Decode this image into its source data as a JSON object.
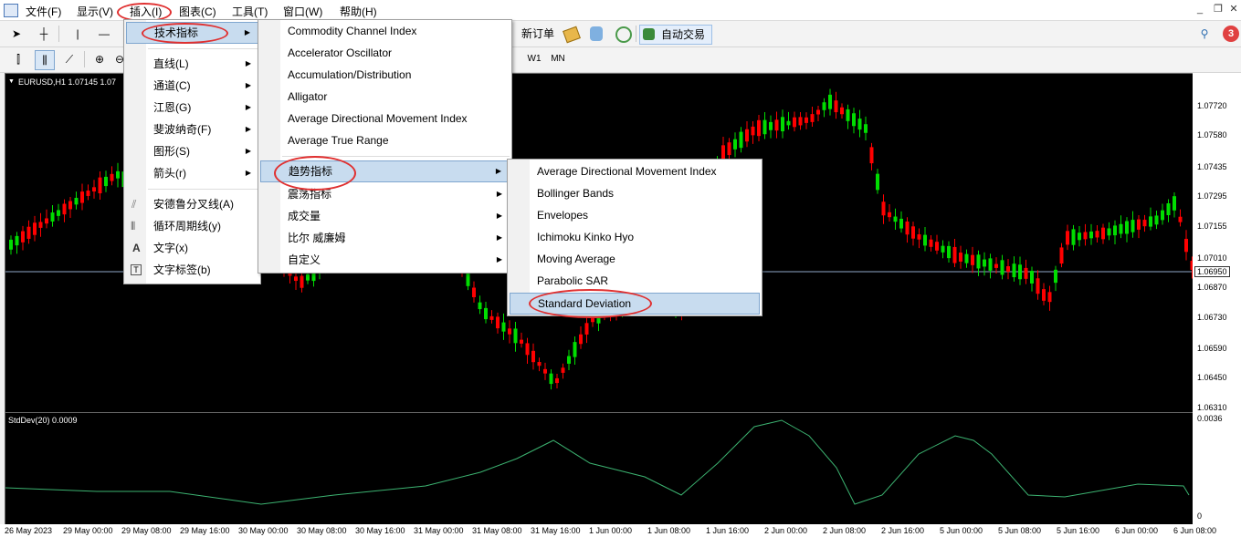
{
  "menubar": {
    "items": [
      "文件(F)",
      "显示(V)",
      "插入(I)",
      "图表(C)",
      "工具(T)",
      "窗口(W)",
      "帮助(H)"
    ]
  },
  "toolbar": {
    "new_order": "新订单",
    "auto_trading": "自动交易",
    "timeframes": [
      "W1",
      "MN"
    ],
    "notification_count": "3"
  },
  "chart": {
    "title": "EURUSD,H1  1.07145 1.07",
    "indicator_label": "StdDev(20) 0.0009",
    "price_labels": [
      "1.07720",
      "1.07580",
      "1.07435",
      "1.07295",
      "1.07155",
      "1.07010",
      "1.06950",
      "1.06870",
      "1.06730",
      "1.06590",
      "1.06450",
      "1.06310"
    ],
    "current_price": "1.06950",
    "indicator_labels": [
      "0.0036",
      "0"
    ],
    "time_labels": [
      "26 May 2023",
      "29 May 00:00",
      "29 May 08:00",
      "29 May 16:00",
      "30 May 00:00",
      "30 May 08:00",
      "30 May 16:00",
      "31 May 00:00",
      "31 May 08:00",
      "31 May 16:00",
      "1 Jun 00:00",
      "1 Jun 08:00",
      "1 Jun 16:00",
      "2 Jun 00:00",
      "2 Jun 08:00",
      "2 Jun 16:00",
      "5 Jun 00:00",
      "5 Jun 08:00",
      "5 Jun 16:00",
      "6 Jun 00:00",
      "6 Jun 08:00"
    ],
    "colors": {
      "bull": "#00dd00",
      "bear": "#ff0000",
      "indicator": "#3cb371"
    }
  },
  "insert_menu": {
    "items": [
      {
        "label": "技术指标",
        "arrow": "▶"
      },
      {
        "label": "直线(L)",
        "arrow": "▶"
      },
      {
        "label": "通道(C)",
        "arrow": "▶"
      },
      {
        "label": "江恩(G)",
        "arrow": "▶"
      },
      {
        "label": "斐波纳奇(F)",
        "arrow": "▶"
      },
      {
        "label": "图形(S)",
        "arrow": "▶"
      },
      {
        "label": "箭头(r)",
        "arrow": "▶"
      },
      {
        "label": "安德鲁分叉线(A)",
        "arrow": ""
      },
      {
        "label": "循环周期线(y)",
        "arrow": ""
      },
      {
        "label": "文字(x)",
        "arrow": ""
      },
      {
        "label": "文字标签(b)",
        "arrow": ""
      }
    ]
  },
  "indicators_menu": {
    "items": [
      {
        "label": "Commodity Channel Index",
        "arrow": ""
      },
      {
        "label": "Accelerator Oscillator",
        "arrow": ""
      },
      {
        "label": "Accumulation/Distribution",
        "arrow": ""
      },
      {
        "label": "Alligator",
        "arrow": ""
      },
      {
        "label": "Average Directional Movement Index",
        "arrow": ""
      },
      {
        "label": "Average True Range",
        "arrow": ""
      },
      {
        "label": "趋势指标",
        "arrow": "▶"
      },
      {
        "label": "震荡指标",
        "arrow": "▶"
      },
      {
        "label": "成交量",
        "arrow": "▶"
      },
      {
        "label": "比尔 威廉姆",
        "arrow": "▶"
      },
      {
        "label": "自定义",
        "arrow": "▶"
      }
    ]
  },
  "trend_menu": {
    "items": [
      {
        "label": "Average Directional Movement Index"
      },
      {
        "label": "Bollinger Bands"
      },
      {
        "label": "Envelopes"
      },
      {
        "label": "Ichimoku Kinko Hyo"
      },
      {
        "label": "Moving Average"
      },
      {
        "label": "Parabolic SAR"
      },
      {
        "label": "Standard Deviation"
      }
    ]
  }
}
